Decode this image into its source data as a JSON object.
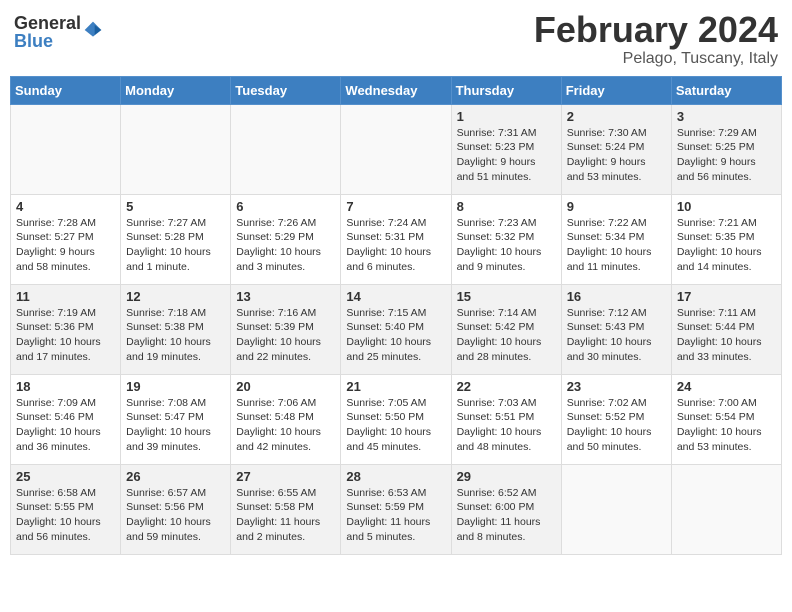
{
  "logo": {
    "general": "General",
    "blue": "Blue"
  },
  "title": {
    "month": "February 2024",
    "location": "Pelago, Tuscany, Italy"
  },
  "headers": [
    "Sunday",
    "Monday",
    "Tuesday",
    "Wednesday",
    "Thursday",
    "Friday",
    "Saturday"
  ],
  "weeks": [
    [
      {
        "day": "",
        "info": ""
      },
      {
        "day": "",
        "info": ""
      },
      {
        "day": "",
        "info": ""
      },
      {
        "day": "",
        "info": ""
      },
      {
        "day": "1",
        "info": "Sunrise: 7:31 AM\nSunset: 5:23 PM\nDaylight: 9 hours\nand 51 minutes."
      },
      {
        "day": "2",
        "info": "Sunrise: 7:30 AM\nSunset: 5:24 PM\nDaylight: 9 hours\nand 53 minutes."
      },
      {
        "day": "3",
        "info": "Sunrise: 7:29 AM\nSunset: 5:25 PM\nDaylight: 9 hours\nand 56 minutes."
      }
    ],
    [
      {
        "day": "4",
        "info": "Sunrise: 7:28 AM\nSunset: 5:27 PM\nDaylight: 9 hours\nand 58 minutes."
      },
      {
        "day": "5",
        "info": "Sunrise: 7:27 AM\nSunset: 5:28 PM\nDaylight: 10 hours\nand 1 minute."
      },
      {
        "day": "6",
        "info": "Sunrise: 7:26 AM\nSunset: 5:29 PM\nDaylight: 10 hours\nand 3 minutes."
      },
      {
        "day": "7",
        "info": "Sunrise: 7:24 AM\nSunset: 5:31 PM\nDaylight: 10 hours\nand 6 minutes."
      },
      {
        "day": "8",
        "info": "Sunrise: 7:23 AM\nSunset: 5:32 PM\nDaylight: 10 hours\nand 9 minutes."
      },
      {
        "day": "9",
        "info": "Sunrise: 7:22 AM\nSunset: 5:34 PM\nDaylight: 10 hours\nand 11 minutes."
      },
      {
        "day": "10",
        "info": "Sunrise: 7:21 AM\nSunset: 5:35 PM\nDaylight: 10 hours\nand 14 minutes."
      }
    ],
    [
      {
        "day": "11",
        "info": "Sunrise: 7:19 AM\nSunset: 5:36 PM\nDaylight: 10 hours\nand 17 minutes."
      },
      {
        "day": "12",
        "info": "Sunrise: 7:18 AM\nSunset: 5:38 PM\nDaylight: 10 hours\nand 19 minutes."
      },
      {
        "day": "13",
        "info": "Sunrise: 7:16 AM\nSunset: 5:39 PM\nDaylight: 10 hours\nand 22 minutes."
      },
      {
        "day": "14",
        "info": "Sunrise: 7:15 AM\nSunset: 5:40 PM\nDaylight: 10 hours\nand 25 minutes."
      },
      {
        "day": "15",
        "info": "Sunrise: 7:14 AM\nSunset: 5:42 PM\nDaylight: 10 hours\nand 28 minutes."
      },
      {
        "day": "16",
        "info": "Sunrise: 7:12 AM\nSunset: 5:43 PM\nDaylight: 10 hours\nand 30 minutes."
      },
      {
        "day": "17",
        "info": "Sunrise: 7:11 AM\nSunset: 5:44 PM\nDaylight: 10 hours\nand 33 minutes."
      }
    ],
    [
      {
        "day": "18",
        "info": "Sunrise: 7:09 AM\nSunset: 5:46 PM\nDaylight: 10 hours\nand 36 minutes."
      },
      {
        "day": "19",
        "info": "Sunrise: 7:08 AM\nSunset: 5:47 PM\nDaylight: 10 hours\nand 39 minutes."
      },
      {
        "day": "20",
        "info": "Sunrise: 7:06 AM\nSunset: 5:48 PM\nDaylight: 10 hours\nand 42 minutes."
      },
      {
        "day": "21",
        "info": "Sunrise: 7:05 AM\nSunset: 5:50 PM\nDaylight: 10 hours\nand 45 minutes."
      },
      {
        "day": "22",
        "info": "Sunrise: 7:03 AM\nSunset: 5:51 PM\nDaylight: 10 hours\nand 48 minutes."
      },
      {
        "day": "23",
        "info": "Sunrise: 7:02 AM\nSunset: 5:52 PM\nDaylight: 10 hours\nand 50 minutes."
      },
      {
        "day": "24",
        "info": "Sunrise: 7:00 AM\nSunset: 5:54 PM\nDaylight: 10 hours\nand 53 minutes."
      }
    ],
    [
      {
        "day": "25",
        "info": "Sunrise: 6:58 AM\nSunset: 5:55 PM\nDaylight: 10 hours\nand 56 minutes."
      },
      {
        "day": "26",
        "info": "Sunrise: 6:57 AM\nSunset: 5:56 PM\nDaylight: 10 hours\nand 59 minutes."
      },
      {
        "day": "27",
        "info": "Sunrise: 6:55 AM\nSunset: 5:58 PM\nDaylight: 11 hours\nand 2 minutes."
      },
      {
        "day": "28",
        "info": "Sunrise: 6:53 AM\nSunset: 5:59 PM\nDaylight: 11 hours\nand 5 minutes."
      },
      {
        "day": "29",
        "info": "Sunrise: 6:52 AM\nSunset: 6:00 PM\nDaylight: 11 hours\nand 8 minutes."
      },
      {
        "day": "",
        "info": ""
      },
      {
        "day": "",
        "info": ""
      }
    ]
  ]
}
